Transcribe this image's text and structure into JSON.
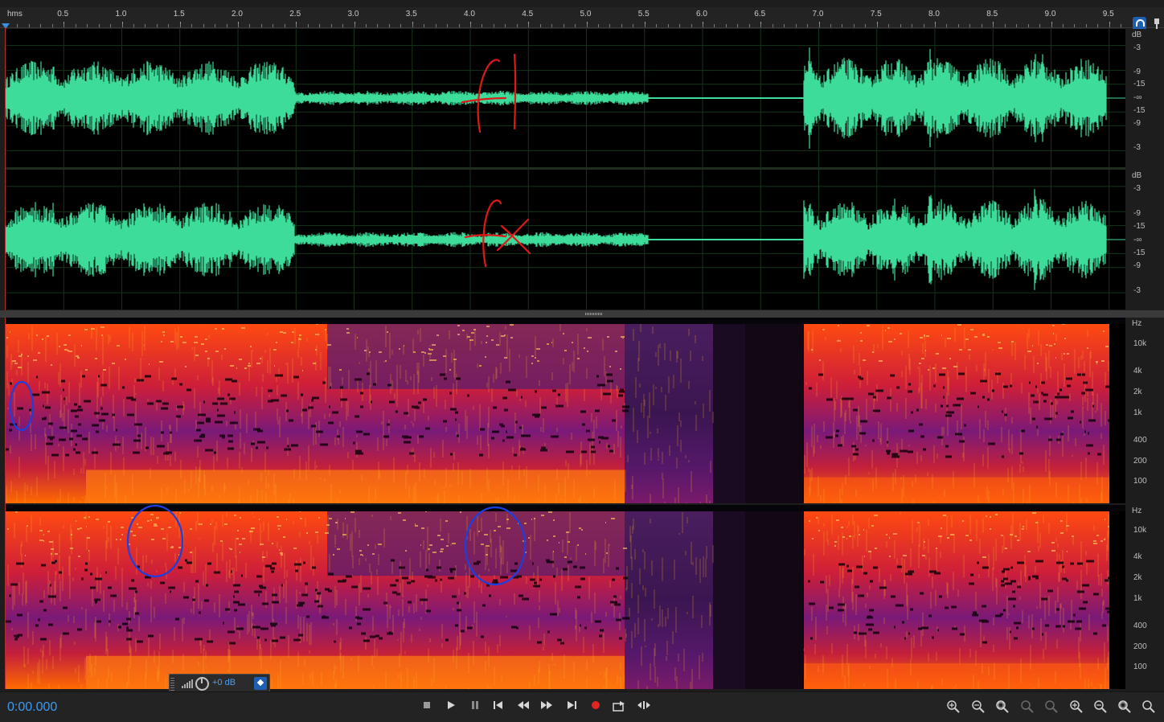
{
  "ruler": {
    "unit": "hms",
    "ticks": [
      "0.5",
      "1.0",
      "1.5",
      "2.0",
      "2.5",
      "3.0",
      "3.5",
      "4.0",
      "4.5",
      "5.0",
      "5.5",
      "6.0",
      "6.5",
      "7.0",
      "7.5",
      "8.0",
      "8.5",
      "9.0",
      "9.5"
    ]
  },
  "waveform_scale": {
    "unit": "dB",
    "labels": [
      "-3",
      "-9",
      "-15",
      "-∞",
      "-15",
      "-9",
      "-3"
    ]
  },
  "spectral_scale": {
    "unit": "Hz",
    "labels": [
      "10k",
      "4k",
      "2k",
      "1k",
      "400",
      "200",
      "100"
    ]
  },
  "annotations": {
    "waveform_left": "fl",
    "waveform_right": "fx"
  },
  "hud": {
    "gain": "+0 dB"
  },
  "transport": {
    "time": "0:00.000",
    "buttons": [
      "stop",
      "play",
      "pause",
      "move-playhead-to-previous",
      "rewind",
      "fast-forward",
      "move-playhead-to-next",
      "record",
      "skip-selection",
      "loop"
    ]
  },
  "zoom_buttons": [
    "zoom-in-amplitude",
    "zoom-out-amplitude",
    "zoom-out-full",
    "zoom-in-at-in-point",
    "zoom-in-at-out-point",
    "zoom-in-time",
    "zoom-out-time",
    "zoom-full",
    "zoom-selection"
  ],
  "colors": {
    "waveform": "#3ddc9a",
    "accent": "#3f9af2",
    "pen_red": "#e01818",
    "pen_blue": "#1b3fe0",
    "record": "#e22424"
  }
}
